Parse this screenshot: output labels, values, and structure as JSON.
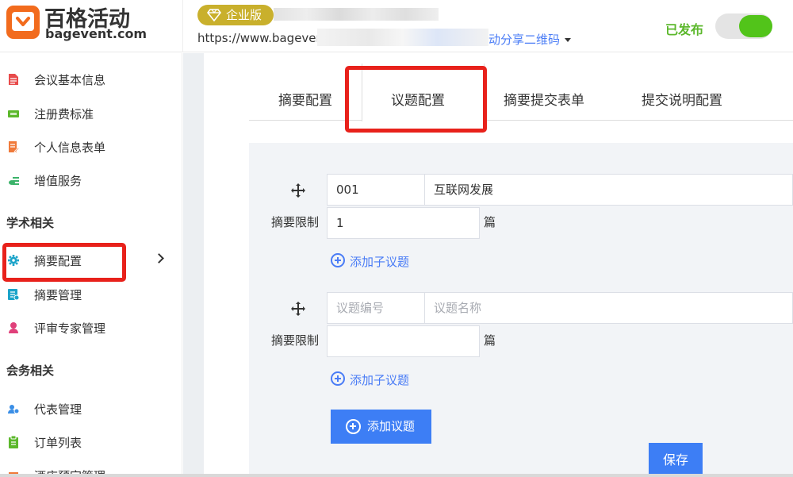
{
  "header": {
    "logo_title": "百格活动",
    "logo_domain": "bagevent.com",
    "edition_badge": "企业版",
    "event_url": "https://www.bagevent",
    "share_qr_label": "动分享二维码",
    "status_label": "已发布",
    "published_toggle_on": true,
    "accent_color": "#52c41a"
  },
  "sidebar": {
    "items_top": [
      {
        "label": "会议基本信息",
        "icon": "document-icon",
        "color": "#e84b4b"
      },
      {
        "label": "注册费标准",
        "icon": "ticket-icon",
        "color": "#5cb82c"
      },
      {
        "label": "个人信息表单",
        "icon": "form-edit-icon",
        "color": "#f07a3a"
      },
      {
        "label": "增值服务",
        "icon": "coins-icon",
        "color": "#3bb36a"
      }
    ],
    "section_academic": "学术相关",
    "items_academic": [
      {
        "label": "摘要配置",
        "icon": "gear-icon",
        "color": "#1aa3c9",
        "active": true
      },
      {
        "label": "摘要管理",
        "icon": "list-icon",
        "color": "#1aa3c9"
      },
      {
        "label": "评审专家管理",
        "icon": "person-icon",
        "color": "#e0407a"
      }
    ],
    "section_affairs": "会务相关",
    "items_affairs": [
      {
        "label": "代表管理",
        "icon": "users-icon",
        "color": "#3a8ee6"
      },
      {
        "label": "订单列表",
        "icon": "clipboard-icon",
        "color": "#5cb82c"
      },
      {
        "label": "酒店预定管理",
        "icon": "hotel-icon",
        "color": "#f07a3a"
      }
    ]
  },
  "tabs": [
    {
      "label": "摘要配置"
    },
    {
      "label": "议题配置",
      "active": true
    },
    {
      "label": "摘要提交表单"
    },
    {
      "label": "提交说明配置"
    }
  ],
  "topics": [
    {
      "code_value": "001",
      "code_placeholder": "议题编号",
      "name_value": "互联网发展",
      "name_placeholder": "议题名称",
      "limit_label": "摘要限制",
      "limit_value": "1",
      "limit_unit": "篇",
      "add_sub_label": "添加子议题"
    },
    {
      "code_value": "",
      "code_placeholder": "议题编号",
      "name_value": "",
      "name_placeholder": "议题名称",
      "limit_label": "摘要限制",
      "limit_value": "",
      "limit_unit": "篇",
      "add_sub_label": "添加子议题"
    }
  ],
  "add_topic_label": "添加议题",
  "save_label": "保存",
  "highlight_color": "#e8211b"
}
